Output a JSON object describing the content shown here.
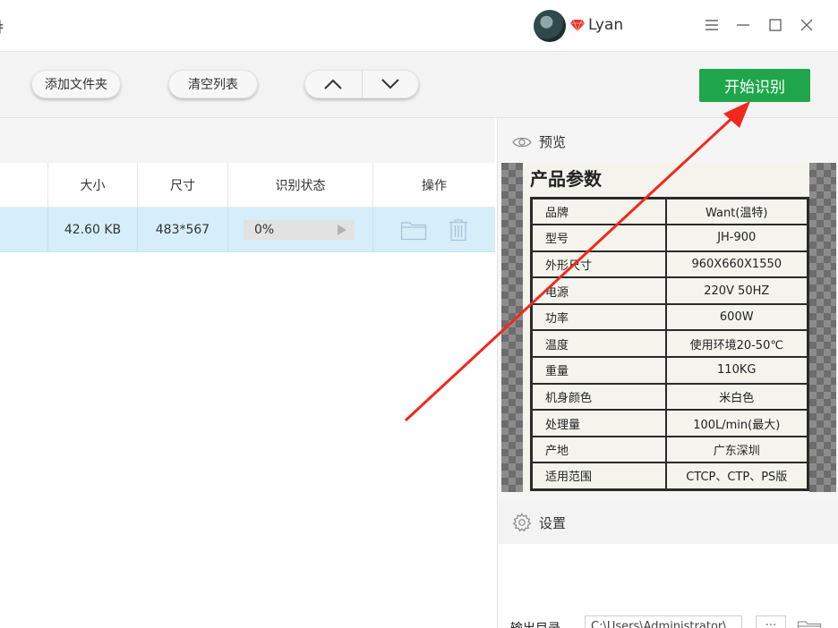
{
  "titlebar": {
    "title_fragment": "ǂ",
    "username": "Lyan",
    "icons": [
      "avatar",
      "vip-diamond-icon",
      "menu-icon",
      "minimize-icon",
      "maximize-icon",
      "close-icon"
    ]
  },
  "toolbar": {
    "add_folder_label": "添加文件夹",
    "clear_list_label": "清空列表",
    "move_up_icon": "chevron-up-icon",
    "move_down_icon": "chevron-down-icon",
    "start_label": "开始识别",
    "start_color": "#1fa64b"
  },
  "file_table": {
    "columns": [
      "大小",
      "尺寸",
      "识别状态",
      "操作"
    ],
    "rows": [
      {
        "size": "42.60 KB",
        "dimensions": "483*567",
        "status": "0%",
        "progress": 0,
        "actions": [
          "folder-icon",
          "trash-icon"
        ]
      }
    ],
    "selected_row_color": "#d6eefa"
  },
  "preview": {
    "heading": "预览",
    "image": {
      "title": "产品参数",
      "specs": [
        {
          "key": "品牌",
          "value": "Want(温特)"
        },
        {
          "key": "型号",
          "value": "JH-900"
        },
        {
          "key": "外形尺寸",
          "value": "960X660X1550"
        },
        {
          "key": "电源",
          "value": "220V  50HZ"
        },
        {
          "key": "功率",
          "value": "600W"
        },
        {
          "key": "温度",
          "value": "使用环境20-50℃"
        },
        {
          "key": "重量",
          "value": "110KG"
        },
        {
          "key": "机身颜色",
          "value": "米白色"
        },
        {
          "key": "处理量",
          "value": "100L/min(最大)"
        },
        {
          "key": "产地",
          "value": "广东深圳"
        },
        {
          "key": "适用范围",
          "value": "CTCP、CTP、PS版"
        }
      ]
    }
  },
  "settings": {
    "heading": "设置",
    "output_label": "输出目录",
    "output_path": "C:\\Users\\Administrator\\",
    "more_button": "···"
  },
  "annotation": {
    "arrow_color": "#f0281e"
  }
}
